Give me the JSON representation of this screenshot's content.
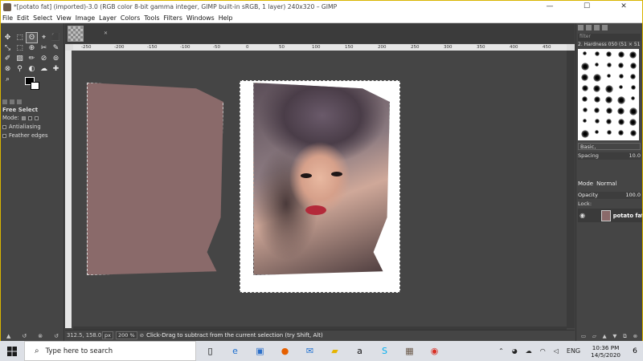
{
  "window": {
    "title": "*[potato fat] (imported)-3.0 (RGB color 8-bit gamma integer, GIMP built-in sRGB, 1 layer) 240x320 – GIMP",
    "minimize": "—",
    "maximize": "☐",
    "close": "✕"
  },
  "menu": [
    "File",
    "Edit",
    "Select",
    "View",
    "Image",
    "Layer",
    "Colors",
    "Tools",
    "Filters",
    "Windows",
    "Help"
  ],
  "toolbox": {
    "tools": [
      "✥",
      "⬚",
      "ʘ",
      "⌖",
      "⬛",
      "⤡",
      "⬚",
      "⊕",
      "✂",
      "✎",
      "✐",
      "▨",
      "✏",
      "⊘",
      "⊚",
      "⊗",
      "⚲",
      "◐",
      "☁",
      "✚",
      "⌕"
    ],
    "selected_index": 2
  },
  "tool_options": {
    "title": "Free Select",
    "mode_label": "Mode:",
    "antialiasing": "Antialiasing",
    "feather": "Feather edges"
  },
  "canvas": {
    "ruler_ticks": [
      "-250",
      "-200",
      "-150",
      "-100",
      "-50",
      "0",
      "50",
      "100",
      "150",
      "200",
      "250",
      "300",
      "350",
      "400",
      "450"
    ]
  },
  "status": {
    "coords": "312.5, 158.0",
    "unit": "px",
    "zoom": "200 %",
    "message": "Click-Drag to subtract from the current selection (try Shift, Alt)"
  },
  "brushes": {
    "filter_placeholder": "filter",
    "name": "2. Hardness 050 (51 × 51)",
    "preset": "Basic,",
    "spacing_label": "Spacing",
    "spacing_value": "10.0"
  },
  "layers": {
    "mode_label": "Mode",
    "mode_value": "Normal",
    "opacity_label": "Opacity",
    "opacity_value": "100.0",
    "lock_label": "Lock:",
    "layer_name": "potato fat"
  },
  "taskbar": {
    "search_placeholder": "Type here to search",
    "lang": "ENG",
    "time": "10:36 PM",
    "date": "14/5/2020",
    "notif_count": "6"
  }
}
